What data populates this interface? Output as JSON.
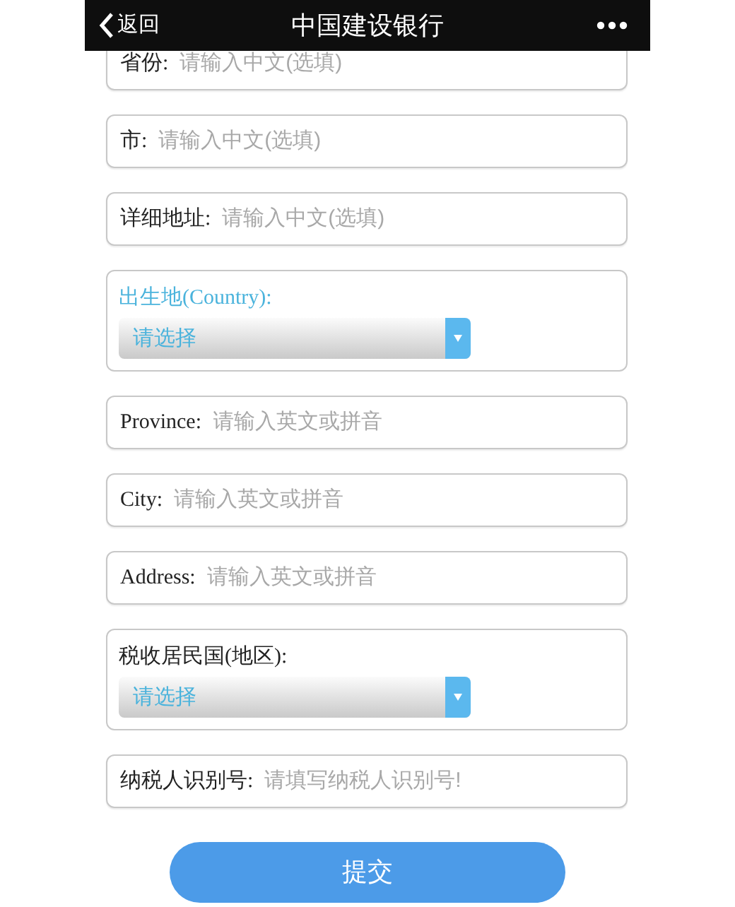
{
  "header": {
    "back": "返回",
    "title": "中国建设银行"
  },
  "fields": [
    {
      "kind": "text",
      "label": "省份:",
      "placeholder": "请输入中文(选填)"
    },
    {
      "kind": "text",
      "label": "市:",
      "placeholder": "请输入中文(选填)"
    },
    {
      "kind": "text",
      "label": "详细地址:",
      "placeholder": "请输入中文(选填)"
    },
    {
      "kind": "select",
      "label": "出生地(Country):",
      "highlighted": true,
      "value": "请选择"
    },
    {
      "kind": "text",
      "label": "Province:",
      "placeholder": "请输入英文或拼音"
    },
    {
      "kind": "text",
      "label": "City:",
      "placeholder": "请输入英文或拼音"
    },
    {
      "kind": "text",
      "label": "Address:",
      "placeholder": "请输入英文或拼音"
    },
    {
      "kind": "select",
      "label": "税收居民国(地区):",
      "highlighted": false,
      "value": "请选择"
    },
    {
      "kind": "text",
      "label": "纳税人识别号:",
      "placeholder": "请填写纳税人识别号!"
    }
  ],
  "submit": "提交"
}
